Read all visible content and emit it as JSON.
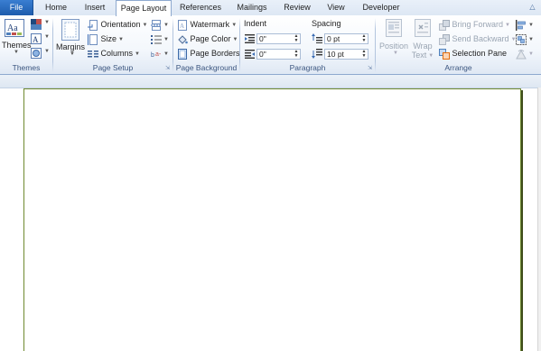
{
  "tabs": [
    "File",
    "Home",
    "Insert",
    "Page Layout",
    "References",
    "Mailings",
    "Review",
    "View",
    "Developer"
  ],
  "active_tab": "Page Layout",
  "groups": {
    "themes": {
      "label": "Themes",
      "themes_button": "Themes"
    },
    "page_setup": {
      "label": "Page Setup",
      "margins": "Margins",
      "orientation": "Orientation",
      "size": "Size",
      "columns": "Columns"
    },
    "page_background": {
      "label": "Page Background",
      "watermark": "Watermark",
      "page_color": "Page Color",
      "page_borders": "Page Borders"
    },
    "paragraph": {
      "label": "Paragraph",
      "indent_header": "Indent",
      "spacing_header": "Spacing",
      "indent_left": "0\"",
      "indent_right": "0\"",
      "spacing_before": "0 pt",
      "spacing_after": "10 pt"
    },
    "arrange": {
      "label": "Arrange",
      "position": "Position",
      "wrap_text_1": "Wrap",
      "wrap_text_2": "Text",
      "bring_forward": "Bring Forward",
      "send_backward": "Send Backward",
      "selection_pane": "Selection Pane"
    }
  },
  "colors": {
    "file_tab": "#2a6bc0",
    "page_border": "#6f8a2f",
    "ribbon_text": "#1e395b"
  }
}
